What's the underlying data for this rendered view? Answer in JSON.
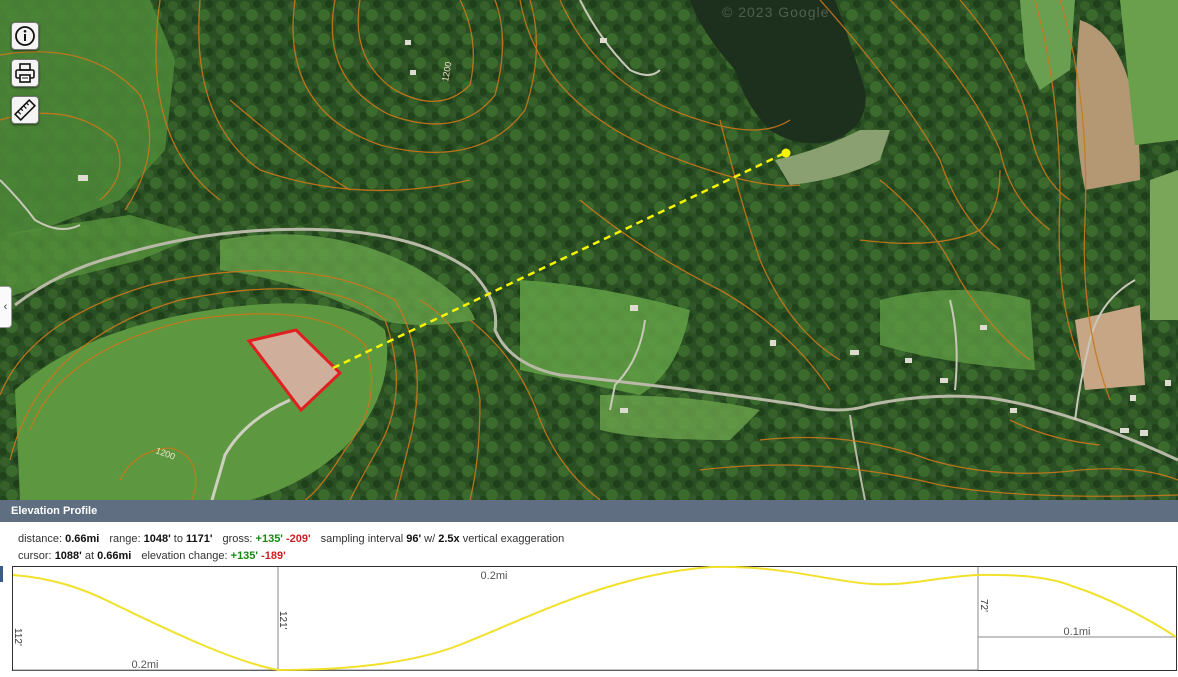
{
  "map": {
    "watermark": "© 2023 Google",
    "tools": [
      {
        "name": "info-icon"
      },
      {
        "name": "print-icon"
      },
      {
        "name": "ruler-icon"
      }
    ],
    "side_toggle": "‹",
    "contour_labels": [
      "1200",
      "1200"
    ],
    "colors": {
      "contour": "#c8781c",
      "measure_line": "#f5f500",
      "parcel": "#e02020"
    }
  },
  "panel": {
    "title": "Elevation Profile",
    "distance_label": "distance:",
    "distance": "0.66mi",
    "range_label": "range:",
    "range_low": "1048'",
    "range_to": "to",
    "range_high": "1171'",
    "gross_label": "gross:",
    "gross_gain": "+135'",
    "gross_loss": "-209'",
    "sampling_prefix": "sampling interval",
    "sampling_interval": "96'",
    "sampling_mid": "w/",
    "exaggeration": "2.5x",
    "sampling_suffix": "vertical exaggeration",
    "cursor_label": "cursor:",
    "cursor_elev": "1088'",
    "cursor_at": "at",
    "cursor_dist": "0.66mi",
    "change_label": "elevation change:",
    "change_gain": "+135'",
    "change_loss": "-189'"
  },
  "profile": {
    "line_color": "#f2e12a",
    "segments": [
      {
        "height_label": "112'",
        "dist_label": "0.2mi"
      },
      {
        "height_label": "121'",
        "dist_label": "0.2mi"
      },
      {
        "height_label": "72'",
        "dist_label": "0.1mi"
      }
    ]
  }
}
